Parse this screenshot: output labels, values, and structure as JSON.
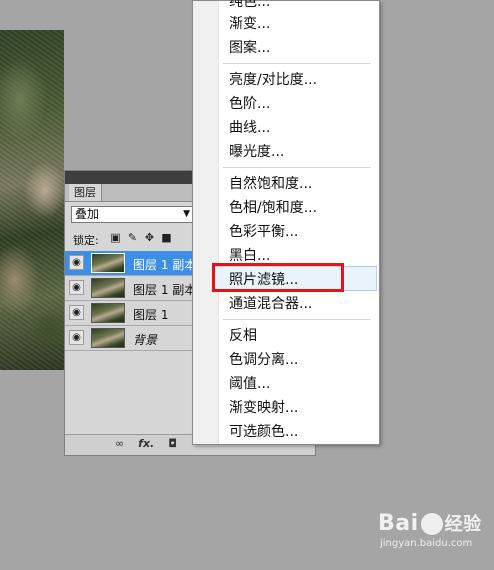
{
  "layers_panel": {
    "tab_label": "图层",
    "blend_mode": "叠加",
    "lock_label": "锁定:",
    "lock_icons": [
      "lock-transparent-icon",
      "lock-brush-icon",
      "lock-move-icon",
      "lock-all-icon"
    ],
    "layers": [
      {
        "name": "图层 1 副本",
        "visible": true,
        "selected": true
      },
      {
        "name": "图层 1 副本",
        "visible": true,
        "selected": false
      },
      {
        "name": "图层 1",
        "visible": true,
        "selected": false
      },
      {
        "name": "背景",
        "visible": true,
        "selected": false
      }
    ],
    "bottom_icons": [
      "link-icon",
      "fx-icon",
      "mask-icon",
      "adjustment-icon"
    ],
    "bottom_labels": {
      "link": "∞",
      "fx": "fx.",
      "mask": "◘"
    }
  },
  "adjust_menu": {
    "items": [
      {
        "label": "纯色..."
      },
      {
        "label": "渐变..."
      },
      {
        "label": "图案..."
      },
      {
        "label": "亮度/对比度..."
      },
      {
        "label": "色阶..."
      },
      {
        "label": "曲线..."
      },
      {
        "label": "曝光度..."
      },
      {
        "label": "自然饱和度..."
      },
      {
        "label": "色相/饱和度..."
      },
      {
        "label": "色彩平衡..."
      },
      {
        "label": "黑白..."
      },
      {
        "label": "照片滤镜...",
        "highlighted": true
      },
      {
        "label": "通道混合器..."
      },
      {
        "label": "反相"
      },
      {
        "label": "色调分离..."
      },
      {
        "label": "阈值..."
      },
      {
        "label": "渐变映射..."
      },
      {
        "label": "可选颜色..."
      }
    ]
  },
  "colors": {
    "selection": "#3c8ee6",
    "highlight_box": "#e2141a",
    "background": "#a5a5a5"
  },
  "watermark": {
    "logo": "Bai",
    "logo_suffix": "经验",
    "url": "jingyan.baidu.com"
  }
}
